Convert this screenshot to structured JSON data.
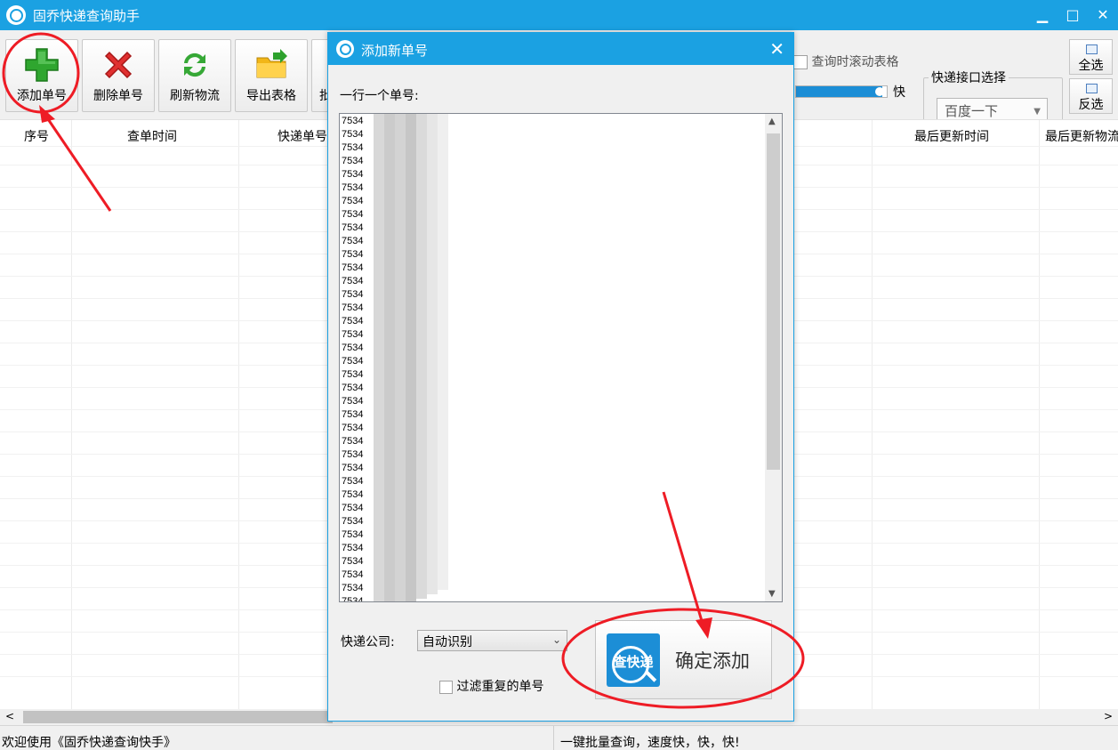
{
  "app": {
    "title": "固乔快递查询助手",
    "min": "▁",
    "max": "□",
    "close": "✕"
  },
  "toolbar": {
    "add": "添加单号",
    "delete": "删除单号",
    "refresh": "刷新物流",
    "export": "导出表格",
    "partial": "批",
    "scroll_option": "查询时滚动表格",
    "speed_label": "快",
    "speed_level_percent": 95,
    "interface_group": "快递接口选择",
    "interface_value": "百度一下",
    "select_all": "全选",
    "invert": "反选"
  },
  "table": {
    "headers": [
      "序号",
      "查单时间",
      "快递单号",
      "最后更新时间",
      "最后更新物流"
    ]
  },
  "status": {
    "left": "欢迎使用《固乔快递查询快手》",
    "right": "一键批量查询，速度快，快，快!"
  },
  "dialog": {
    "title": "添加新单号",
    "close": "✕",
    "instruction": "一行一个单号:",
    "lines": [
      "7534",
      "7534",
      "7534",
      "7534",
      "7534",
      "7534",
      "7534",
      "7534",
      "7534",
      "7534",
      "7534",
      "7534",
      "7534",
      "7534",
      "7534",
      "7534",
      "7534",
      "7534",
      "7534",
      "7534",
      "7534",
      "7534",
      "7534",
      "7534",
      "7534",
      "7534",
      "7534",
      "7534",
      "7534",
      "7534",
      "7534",
      "7534",
      "7534",
      "7534",
      "7534",
      "7534",
      "7534"
    ],
    "company_label": "快递公司:",
    "company_value": "自动识别",
    "filter_label": "过滤重复的单号",
    "confirm_label": "确定添加",
    "logo_text": "查快递"
  },
  "colors": {
    "accent": "#1ba1e2",
    "annotation": "#ee1c25",
    "confirm_icon": "#1c8ed6"
  }
}
